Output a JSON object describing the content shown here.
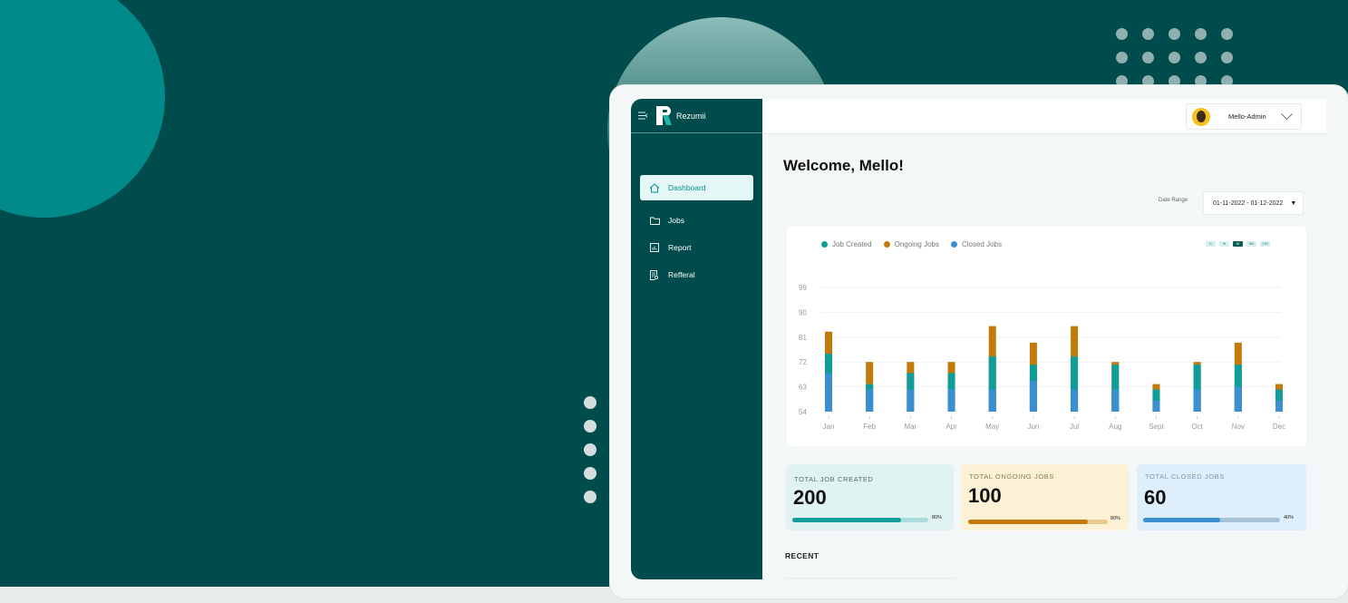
{
  "app": {
    "brand": "Rezumii"
  },
  "sidebar": {
    "items": [
      {
        "label": "Dashboard",
        "icon": "home-icon",
        "active": true
      },
      {
        "label": "Jobs",
        "icon": "folder-icon",
        "active": false
      },
      {
        "label": "Report",
        "icon": "report-icon",
        "active": false
      },
      {
        "label": "Refferal",
        "icon": "referral-icon",
        "active": false
      }
    ]
  },
  "header": {
    "user_name": "Mello-Admin"
  },
  "main": {
    "welcome": "Welcome, Mello!",
    "date_range_label": "Date Range",
    "date_range_value": "01-11-2022 - 01-12-2022",
    "periods": [
      "D",
      "W",
      "M",
      "6M",
      "1YR"
    ],
    "active_period": "M"
  },
  "chart_data": {
    "type": "bar",
    "stacked": true,
    "categories": [
      "Jan",
      "Feb",
      "Mar",
      "Apr",
      "May",
      "Jun",
      "Jul",
      "Aug",
      "Sept",
      "Oct",
      "Nov",
      "Dec"
    ],
    "yticks": [
      54,
      63,
      72,
      81,
      90,
      99
    ],
    "ylim": [
      54,
      99
    ],
    "series": [
      {
        "name": "Closed Jobs",
        "color": "#3a8fd0",
        "values": [
          68,
          62,
          62,
          62,
          62,
          65,
          62,
          62,
          58,
          62,
          63,
          58
        ]
      },
      {
        "name": "Job Created",
        "color": "#0e9d99",
        "values": [
          75,
          64,
          68,
          68,
          74,
          71,
          74,
          71,
          62,
          71,
          71,
          62
        ]
      },
      {
        "name": "Ongoing Jobs",
        "color": "#c27a0a",
        "values": [
          83,
          72,
          72,
          72,
          85,
          79,
          85,
          72,
          64,
          72,
          79,
          64
        ]
      }
    ],
    "legend": [
      "Job Created",
      "Ongoing Jobs",
      "Closed Jobs"
    ],
    "legend_colors": [
      "#0e9d99",
      "#c27a0a",
      "#3a8fd0"
    ],
    "legend_position": "top-left",
    "grid": true
  },
  "stats": [
    {
      "label": "TOTAL JOB CREATED",
      "value": "200",
      "percent": "80%",
      "fill": 0.8,
      "bg": "#e0f3f2",
      "label_color": "#4d6f6e",
      "fill_color": "#0e9d99",
      "track_color": "#a9dcdb"
    },
    {
      "label": "TOTAL ONGOING JOBS",
      "value": "100",
      "percent": "80%",
      "fill": 0.86,
      "bg": "#fcf1d4",
      "label_color": "#8a7a55",
      "fill_color": "#c27a0a",
      "track_color": "#e6c98c"
    },
    {
      "label": "TOTAL CLOSED JOBS",
      "value": "60",
      "percent": "40%",
      "fill": 0.56,
      "bg": "#deeefa",
      "label_color": "#7d97ad",
      "fill_color": "#3a8fd0",
      "track_color": "#a7c3d8"
    }
  ],
  "recent": {
    "title": "RECENT"
  }
}
